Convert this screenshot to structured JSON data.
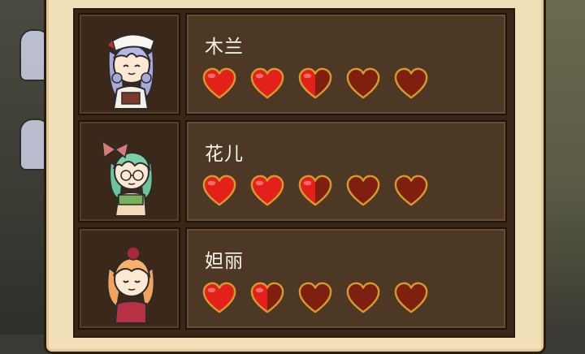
{
  "colors": {
    "heart_full": "#e3211a",
    "heart_empty": "#7e1f10",
    "heart_outline": "#d59a2c",
    "name_text": "#fff6e6"
  },
  "characters": [
    {
      "name": "木兰",
      "portrait_icon": "mulan-portrait",
      "hearts": [
        1,
        1,
        0.5,
        0,
        0
      ]
    },
    {
      "name": "花儿",
      "portrait_icon": "huaer-portrait",
      "hearts": [
        1,
        1,
        0.5,
        0,
        0
      ]
    },
    {
      "name": "妲丽",
      "portrait_icon": "dali-portrait",
      "hearts": [
        1,
        0.5,
        0,
        0,
        0
      ]
    }
  ]
}
